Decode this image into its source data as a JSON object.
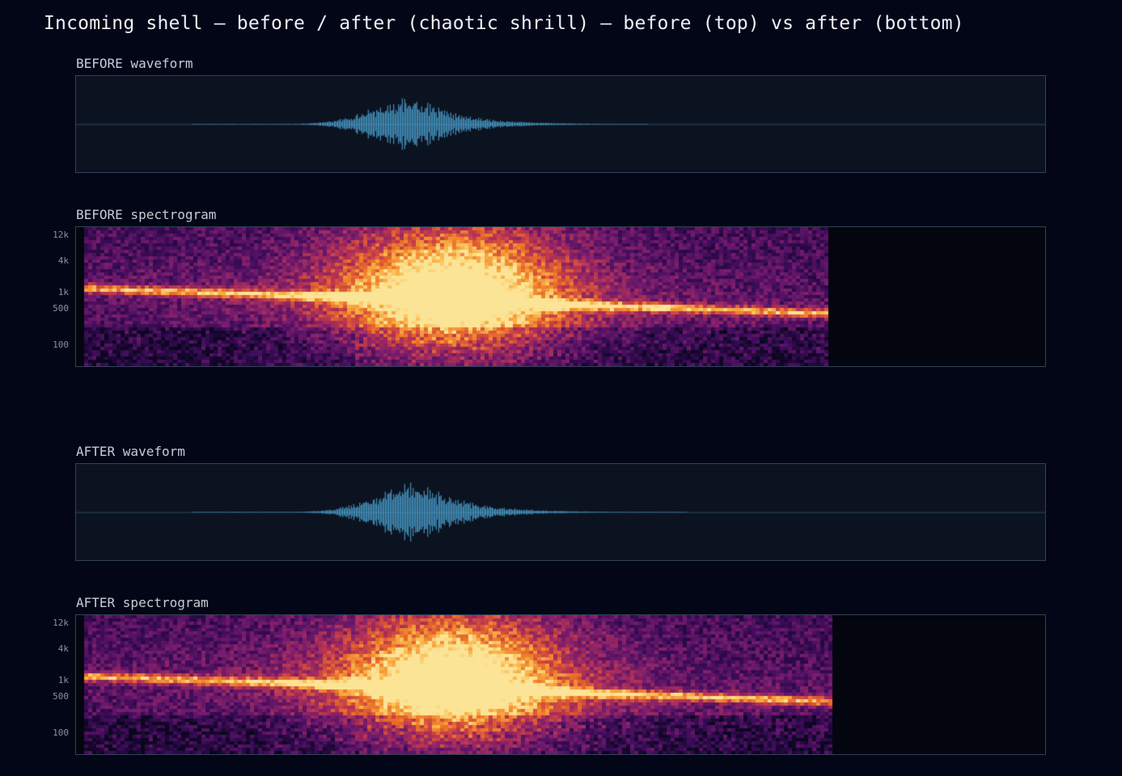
{
  "title": "Incoming shell — before / after (chaotic shrill) — before (top) vs after (bottom)",
  "sections": [
    {
      "id": "before",
      "waveform_label": "BEFORE waveform",
      "spectrogram_label": "BEFORE spectrogram",
      "spectrogram_ticks": [
        "12k",
        "4k",
        "1k",
        "500",
        "100"
      ],
      "waveform": {
        "peak_position": 0.35,
        "peak_amplitude": 0.3,
        "extent_end": 0.59
      },
      "spectrogram": {
        "extent_end": 0.775,
        "burst_position": 0.37
      }
    },
    {
      "id": "after",
      "waveform_label": "AFTER waveform",
      "spectrogram_label": "AFTER spectrogram",
      "spectrogram_ticks": [
        "12k",
        "4k",
        "1k",
        "500",
        "100"
      ],
      "waveform": {
        "peak_position": 0.355,
        "peak_amplitude": 0.34,
        "extent_end": 0.63
      },
      "spectrogram": {
        "extent_end": 0.78,
        "burst_position": 0.37
      }
    }
  ],
  "colors": {
    "waveform": "#4fa8d8",
    "zero_line": "#2a4a5c",
    "panel_border": "#334155",
    "background": "#030616"
  }
}
